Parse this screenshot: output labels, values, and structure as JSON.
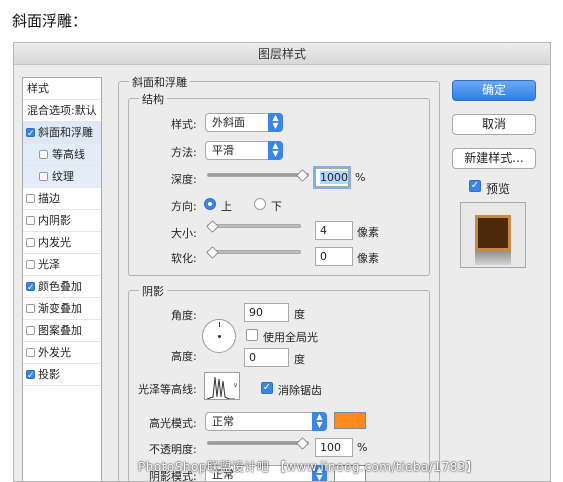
{
  "caption": "斜面浮雕：",
  "dialog": {
    "title": "图层样式",
    "stylelist": {
      "header": "样式",
      "blend_options": "混合选项:默认",
      "items": [
        {
          "label": "斜面和浮雕",
          "checked": true
        },
        {
          "label": "等高线",
          "checked": false
        },
        {
          "label": "纹理",
          "checked": false
        },
        {
          "label": "描边",
          "checked": false
        },
        {
          "label": "内阴影",
          "checked": false
        },
        {
          "label": "内发光",
          "checked": false
        },
        {
          "label": "光泽",
          "checked": false
        },
        {
          "label": "颜色叠加",
          "checked": true
        },
        {
          "label": "渐变叠加",
          "checked": false
        },
        {
          "label": "图案叠加",
          "checked": false
        },
        {
          "label": "外发光",
          "checked": false
        },
        {
          "label": "投影",
          "checked": true
        }
      ]
    },
    "bevel": {
      "section_title": "斜面和浮雕",
      "structure_title": "结构",
      "style_label": "样式:",
      "style_value": "外斜面",
      "technique_label": "方法:",
      "technique_value": "平滑",
      "depth_label": "深度:",
      "depth_value": "1000",
      "depth_unit": "%",
      "direction_label": "方向:",
      "dir_up": "上",
      "dir_down": "下",
      "size_label": "大小:",
      "size_value": "4",
      "size_unit": "像素",
      "soften_label": "软化:",
      "soften_value": "0",
      "soften_unit": "像素"
    },
    "shading": {
      "section_title": "阴影",
      "angle_label": "角度:",
      "angle_value": "90",
      "angle_unit": "度",
      "global_light": "使用全局光",
      "altitude_label": "高度:",
      "altitude_value": "0",
      "altitude_unit": "度",
      "gloss_label": "光泽等高线:",
      "antialias": "消除锯齿",
      "highlight_label": "高光模式:",
      "highlight_value": "正常",
      "highlight_color": "#ff8c1a",
      "opacity_label": "不透明度:",
      "opacity_value": "100",
      "opacity_unit": "%",
      "shadow_mode_label": "阴影模式:",
      "shadow_mode_value": "正常"
    },
    "buttons": {
      "ok": "确定",
      "cancel": "取消",
      "new_style": "新建样式...",
      "preview": "预览"
    }
  },
  "watermark": "PhotoShop联盟设计吧 【www.lineeg.com/tieba/1783】"
}
